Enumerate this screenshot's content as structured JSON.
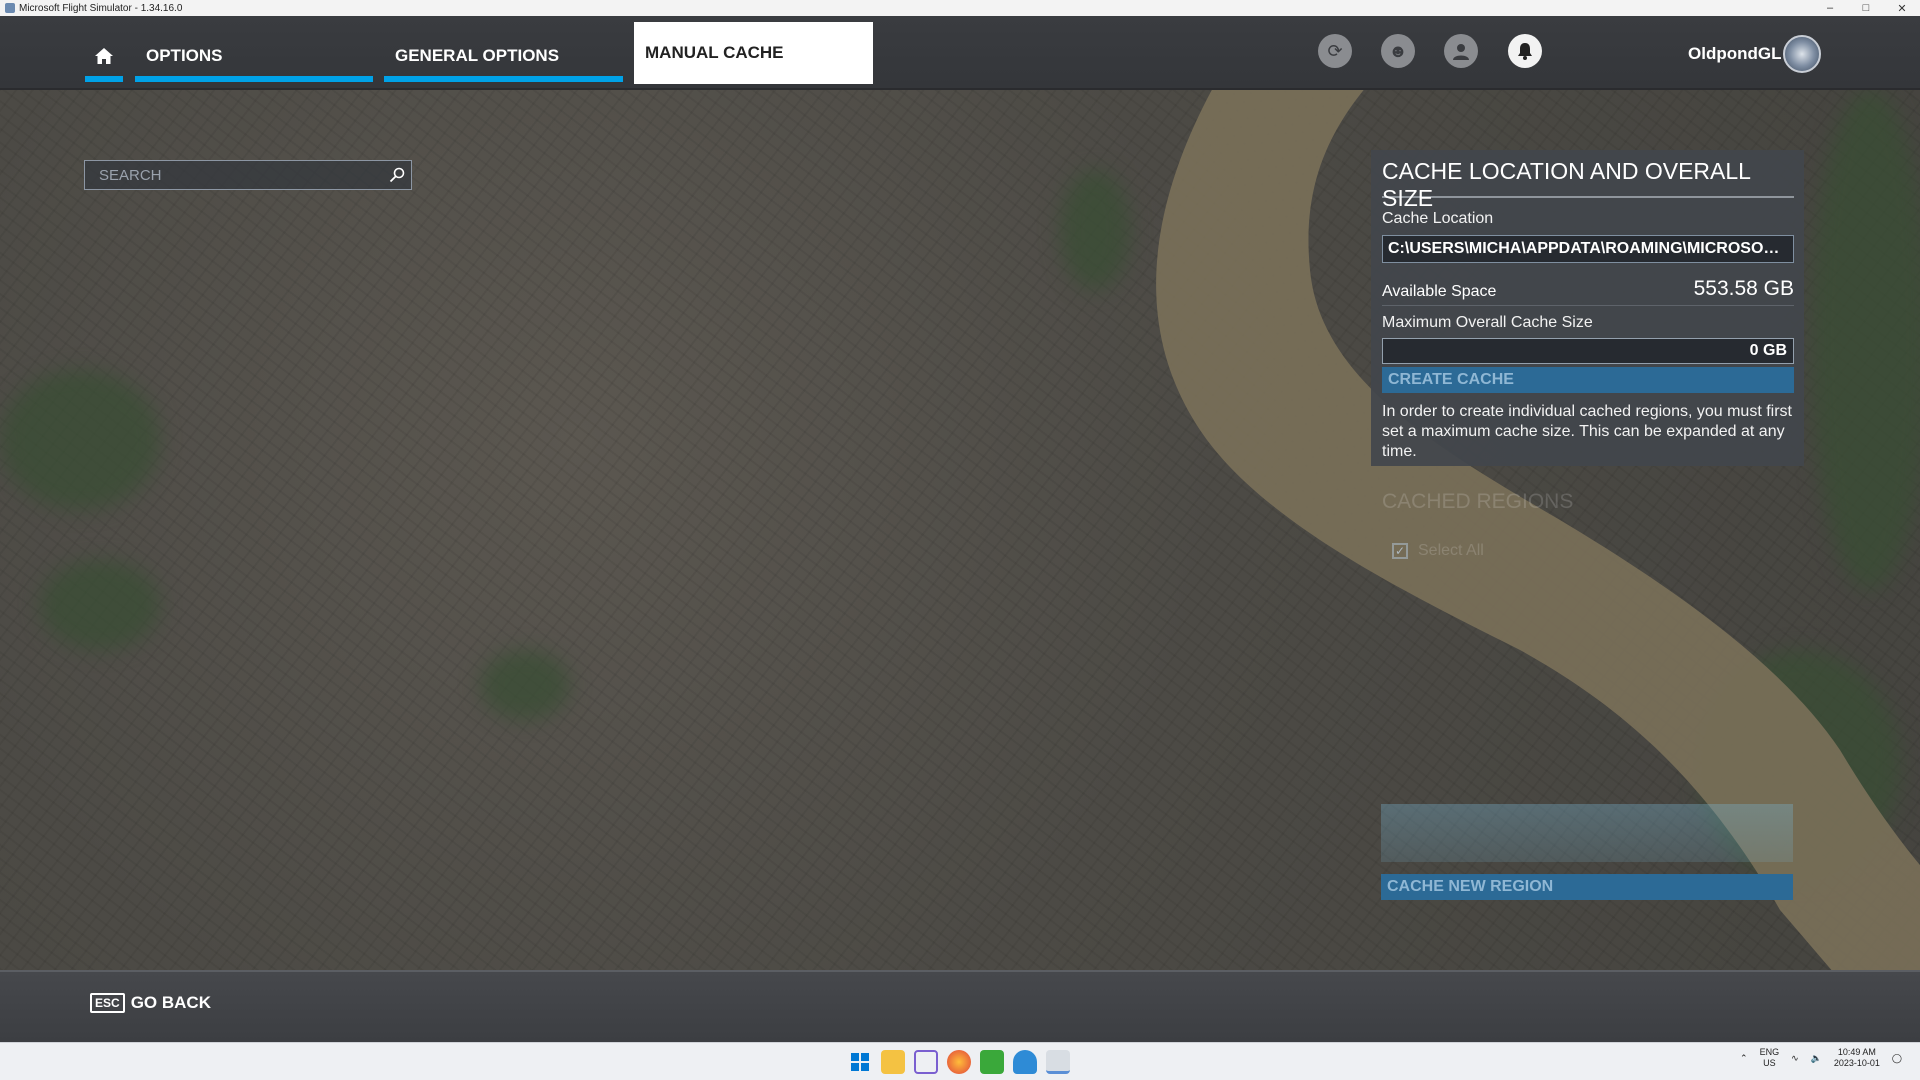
{
  "window": {
    "title": "Microsoft Flight Simulator - 1.34.16.0"
  },
  "nav": {
    "tabs": [
      {
        "label": "OPTIONS"
      },
      {
        "label": "GENERAL OPTIONS"
      },
      {
        "label": "MANUAL CACHE"
      }
    ]
  },
  "user": {
    "name": "OldpondGL"
  },
  "search": {
    "placeholder": "SEARCH"
  },
  "cache_panel": {
    "title": "CACHE LOCATION AND OVERALL SIZE",
    "location_label": "Cache Location",
    "location_value": "C:\\USERS\\MICHA\\APPDATA\\ROAMING\\MICROSOFT FLIGHT SIMULATOR",
    "available_label": "Available Space",
    "available_value": "553.58 GB",
    "max_size_label": "Maximum Overall Cache Size",
    "max_size_value": "0 GB",
    "create_button": "CREATE CACHE",
    "note": "In order to create individual cached regions, you must first set a maximum cache size. This can be expanded at any time."
  },
  "regions": {
    "title": "CACHED REGIONS",
    "select_all": "Select All",
    "cache_new_button": "CACHE NEW REGION"
  },
  "footer": {
    "esc_key": "ESC",
    "go_back": "GO BACK"
  },
  "taskbar": {
    "lang_top": "ENG",
    "lang_bottom": "US",
    "time": "10:49 AM",
    "date": "2023-10-01"
  },
  "colors": {
    "accent": "#00a2e8",
    "button": "#2c6a96"
  }
}
